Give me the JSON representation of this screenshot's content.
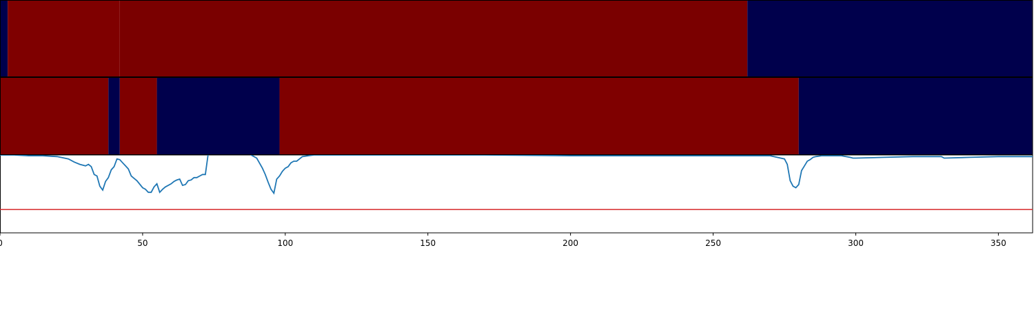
{
  "chart_data": {
    "type": "heatmap",
    "xlim": [
      0,
      362
    ],
    "xticks": [
      0,
      50,
      100,
      150,
      200,
      250,
      300,
      350
    ],
    "tick_labels": [
      "0",
      "50",
      "100",
      "150",
      "200",
      "250",
      "300",
      "350"
    ],
    "colors": {
      "high": "#7f0000",
      "high_dark": "#7a0000",
      "low": "#00004c",
      "line": "#1f77b4",
      "threshold": "#d62728"
    },
    "tracks": [
      {
        "segments": [
          {
            "start": 0,
            "end": 2.7,
            "state": "low"
          },
          {
            "start": 2.7,
            "end": 42,
            "state": "high"
          },
          {
            "start": 42,
            "end": 262,
            "state": "high_dark"
          },
          {
            "start": 262,
            "end": 362,
            "state": "low"
          }
        ]
      },
      {
        "segments": [
          {
            "start": 0,
            "end": 38,
            "state": "high"
          },
          {
            "start": 38,
            "end": 42,
            "state": "low"
          },
          {
            "start": 42,
            "end": 55,
            "state": "high"
          },
          {
            "start": 55,
            "end": 98,
            "state": "low"
          },
          {
            "start": 98,
            "end": 280,
            "state": "high"
          },
          {
            "start": 280,
            "end": 362,
            "state": "low"
          }
        ]
      }
    ],
    "signal": {
      "ylim": [
        -1.0,
        0.0
      ],
      "threshold": -0.7,
      "x": [
        0,
        5,
        10,
        15,
        20,
        24,
        26,
        28,
        30,
        31,
        32,
        33,
        34,
        35,
        36,
        37,
        38,
        39,
        40,
        41,
        42,
        43,
        44,
        45,
        46,
        47,
        48,
        50,
        51,
        52,
        53,
        54,
        55,
        56,
        57,
        58,
        59,
        60,
        61,
        62,
        63,
        64,
        65,
        66,
        67,
        68,
        69,
        70,
        71,
        72,
        73,
        74,
        75,
        80,
        85,
        88,
        90,
        92,
        93,
        94,
        95,
        96,
        97,
        98,
        99,
        100,
        101,
        102,
        103,
        104,
        105,
        106,
        110,
        140,
        170,
        200,
        230,
        260,
        270,
        275,
        276,
        277,
        278,
        279,
        280,
        281,
        282,
        283,
        284,
        285,
        286,
        288,
        290,
        295,
        298,
        299,
        300,
        310,
        320,
        330,
        331,
        340,
        350,
        362
      ],
      "y": [
        0.0,
        0.0,
        -0.01,
        -0.01,
        -0.02,
        -0.05,
        -0.09,
        -0.12,
        -0.14,
        -0.12,
        -0.15,
        -0.25,
        -0.27,
        -0.4,
        -0.45,
        -0.34,
        -0.29,
        -0.19,
        -0.15,
        -0.05,
        -0.06,
        -0.1,
        -0.14,
        -0.18,
        -0.27,
        -0.3,
        -0.33,
        -0.42,
        -0.44,
        -0.48,
        -0.48,
        -0.41,
        -0.37,
        -0.48,
        -0.44,
        -0.41,
        -0.39,
        -0.37,
        -0.34,
        -0.32,
        -0.31,
        -0.39,
        -0.38,
        -0.33,
        -0.32,
        -0.29,
        -0.29,
        -0.27,
        -0.25,
        -0.25,
        0.02,
        0.3,
        0.3,
        0.3,
        0.3,
        0.0,
        -0.04,
        -0.17,
        -0.25,
        -0.35,
        -0.44,
        -0.49,
        -0.31,
        -0.27,
        -0.21,
        -0.17,
        -0.15,
        -0.1,
        -0.08,
        -0.08,
        -0.05,
        -0.02,
        0.0,
        0.0,
        0.0,
        -0.01,
        -0.01,
        -0.01,
        -0.01,
        -0.05,
        -0.12,
        -0.33,
        -0.4,
        -0.42,
        -0.38,
        -0.2,
        -0.14,
        -0.08,
        -0.06,
        -0.03,
        -0.02,
        -0.01,
        -0.01,
        -0.01,
        -0.03,
        -0.04,
        -0.04,
        -0.03,
        -0.02,
        -0.02,
        -0.04,
        -0.03,
        -0.02,
        -0.02
      ]
    }
  }
}
